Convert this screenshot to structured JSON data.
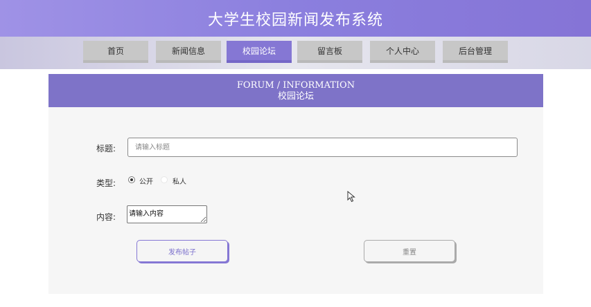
{
  "header": {
    "title": "大学生校园新闻发布系统"
  },
  "nav": {
    "items": [
      {
        "label": "首页"
      },
      {
        "label": "新闻信息"
      },
      {
        "label": "校园论坛"
      },
      {
        "label": "留言板"
      },
      {
        "label": "个人中心"
      },
      {
        "label": "后台管理"
      }
    ],
    "active": "校园论坛"
  },
  "section": {
    "title_en": "FORUM / INFORMATION",
    "title_cn": "校园论坛"
  },
  "form": {
    "title_label": "标题:",
    "title_placeholder": "请输入标题",
    "type_label": "类型:",
    "type_options": [
      {
        "label": "公开",
        "checked": true
      },
      {
        "label": "私人",
        "checked": false
      }
    ],
    "content_label": "内容:",
    "content_placeholder": "请输入内容",
    "submit_label": "发布帖子",
    "reset_label": "重置"
  },
  "colors": {
    "accent": "#8577d4",
    "header": "#8b7fde",
    "section": "#7e73c8"
  }
}
